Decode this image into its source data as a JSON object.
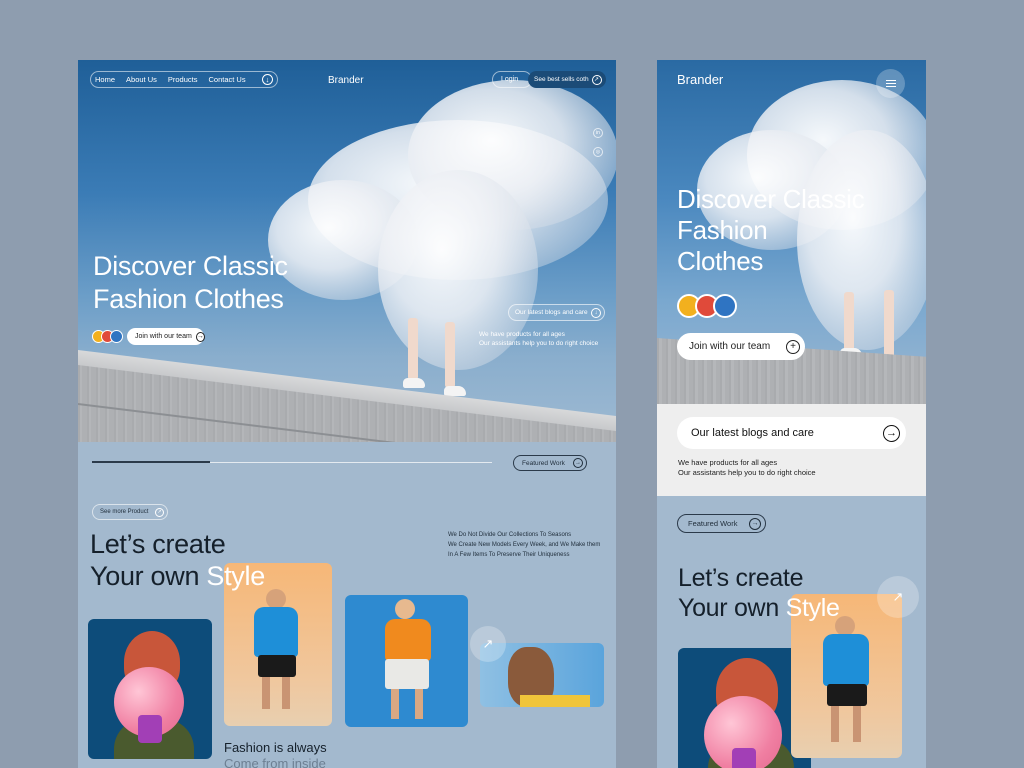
{
  "desktop": {
    "nav": {
      "items": [
        "Home",
        "About Us",
        "Products",
        "Contact Us"
      ],
      "brand": "Brander",
      "login": "Login",
      "best_sells": "See best sells coth"
    },
    "hero": {
      "title_line1": "Discover Classic",
      "title_line2": "Fashion Clothes",
      "join_label": "Join with our team",
      "blogs_label": "Our latest blogs and care",
      "blogs_line1": "We have products for all ages",
      "blogs_line2": "Our assistants help you to do right choice"
    },
    "featured_label": "Featured Work",
    "see_more_label": "See more Product",
    "create_line1": "Let’s create",
    "create_line2_a": "Your own ",
    "create_line2_b": "Style",
    "description": {
      "line1": "We Do Not Divide Our Collections To Seasons",
      "line2": "We Create New Models Every Week, and We Make them",
      "line3": "In A Few Items To Preserve Their Uniqueness"
    },
    "fashion_line1": "Fashion is always",
    "fashion_line2": "Come from inside"
  },
  "mobile": {
    "brand": "Brander",
    "hero": {
      "title_line1": "Discover Classic",
      "title_line2": "Fashion",
      "title_line3": "Clothes",
      "join_label": "Join with our team"
    },
    "blogs_label": "Our latest blogs and care",
    "blogs_line1": "We have products for all ages",
    "blogs_line2": "Our assistants help you to do right choice",
    "featured_label": "Featured Work",
    "create_line1": "Let’s create",
    "create_line2_a": "Your own ",
    "create_line2_b": "Style"
  },
  "icons": {
    "download": "arrow-down-circle-icon",
    "arrow_up_right": "arrow-up-right-icon",
    "arrow_right": "arrow-right-circle-icon",
    "menu": "hamburger-menu-icon"
  },
  "colors": {
    "background": "#8e9daf",
    "panel": "#a3b9ce",
    "sky": "#3b7cb6",
    "dark_text": "#15202b",
    "accent_white": "#ffffff"
  }
}
